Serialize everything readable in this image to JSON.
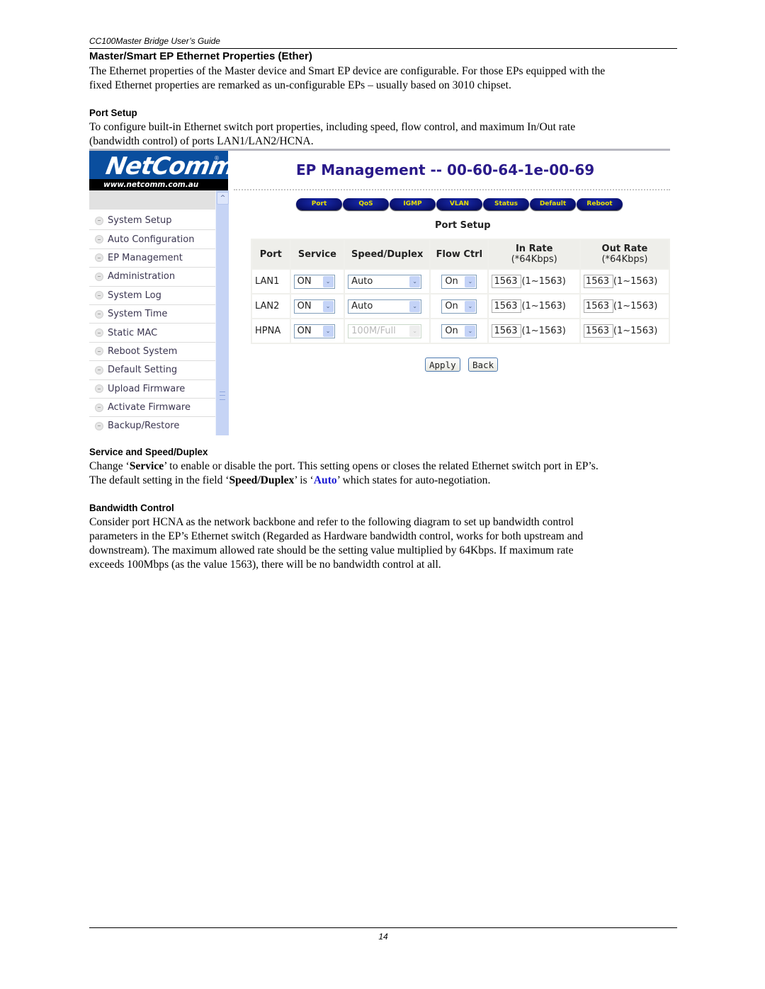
{
  "doc": {
    "running_header": "CC100Master Bridge User’s Guide",
    "page_number": "14"
  },
  "section": {
    "title": "Master/Smart EP Ethernet Properties (Ether)",
    "intro_lines": [
      "The Ethernet properties of the Master device and Smart EP device are configurable. For those EPs equipped with the",
      "fixed Ethernet properties are remarked as un-configurable EPs – usually based on 3010 chipset."
    ]
  },
  "port_setup": {
    "heading": "Port Setup",
    "lines": [
      "To configure built-in Ethernet switch port properties, including speed, flow control, and maximum In/Out rate",
      "(bandwidth control) of ports LAN1/LAN2/HCNA."
    ]
  },
  "screenshot": {
    "logo_text": "NetComm",
    "logo_reg": "®",
    "logo_url": "www.netcomm.com.au",
    "scroll_up_glyph": "^",
    "sidebar_menu": [
      {
        "label": "System Setup",
        "icon": "minus-circle-icon"
      },
      {
        "label": "Auto Configuration",
        "icon": "minus-circle-icon"
      },
      {
        "label": "EP Management",
        "icon": "minus-circle-icon"
      },
      {
        "label": "Administration",
        "icon": "plus-circle-icon"
      },
      {
        "label": "System Log",
        "icon": "plus-circle-icon"
      },
      {
        "label": "System Time",
        "icon": "plus-circle-icon"
      },
      {
        "label": "Static MAC",
        "icon": "minus-circle-icon"
      },
      {
        "label": "Reboot System",
        "icon": "minus-circle-icon"
      },
      {
        "label": "Default Setting",
        "icon": "minus-circle-icon"
      },
      {
        "label": "Upload Firmware",
        "icon": "minus-circle-icon"
      },
      {
        "label": "Activate Firmware",
        "icon": "plus-circle-icon"
      },
      {
        "label": "Backup/Restore",
        "icon": "plus-circle-icon"
      }
    ],
    "page_title": "EP Management -- 00-60-64-1e-00-69",
    "tabs": [
      "Port",
      "QoS",
      "IGMP",
      "VLAN",
      "Status",
      "Default",
      "Reboot"
    ],
    "form_title": "Port Setup",
    "table": {
      "headers": {
        "port": "Port",
        "service": "Service",
        "speed": "Speed/Duplex",
        "flow": "Flow Ctrl",
        "in_rate": "In Rate",
        "in_rate_sub": "(*64Kbps)",
        "out_rate": "Out Rate",
        "out_rate_sub": "(*64Kbps)"
      },
      "rows": [
        {
          "port": "LAN1",
          "service": "ON",
          "speed": "Auto",
          "speed_disabled": false,
          "flow": "On",
          "in_rate": "1563",
          "in_range": "(1~1563)",
          "out_rate": "1563",
          "out_range": "(1~1563)"
        },
        {
          "port": "LAN2",
          "service": "ON",
          "speed": "Auto",
          "speed_disabled": false,
          "flow": "On",
          "in_rate": "1563",
          "in_range": "(1~1563)",
          "out_rate": "1563",
          "out_range": "(1~1563)"
        },
        {
          "port": "HPNA",
          "service": "ON",
          "speed": "100M/Full",
          "speed_disabled": true,
          "flow": "On",
          "in_rate": "1563",
          "in_range": "(1~1563)",
          "out_rate": "1563",
          "out_range": "(1~1563)"
        }
      ]
    },
    "dropdown_glyph": "⌄",
    "buttons": {
      "apply": "Apply",
      "back": "Back"
    },
    "colors": {
      "logo_blue": "#0a4e9e",
      "title_purple": "#2a1a8a",
      "tab_navy": "#0a1270",
      "tab_text_yellow": "#e8e000",
      "scrollbar_blue": "#c6d4f5"
    }
  },
  "service_speed": {
    "heading": "Service and Speed/Duplex",
    "line1_a": "Change ‘",
    "line1_b": "Service",
    "line1_c": "’ to enable or disable the port. This setting opens or closes the related Ethernet switch port in EP’s.",
    "line2_a": "The default setting in the field ‘",
    "line2_b": "Speed/Duplex",
    "line2_c": "’ is ‘",
    "line2_d": "Auto",
    "line2_e": "’ which states for auto-negotiation."
  },
  "bandwidth": {
    "heading": "Bandwidth Control",
    "lines": [
      "Consider port HCNA as the network backbone and refer to the following diagram to set up bandwidth control",
      "parameters in the EP’s Ethernet switch (Regarded as Hardware bandwidth control, works for both upstream and",
      "downstream). The maximum allowed rate should be the setting value multiplied by 64Kbps.  If maximum rate",
      "exceeds 100Mbps (as the value 1563), there will be no bandwidth control at all."
    ]
  }
}
